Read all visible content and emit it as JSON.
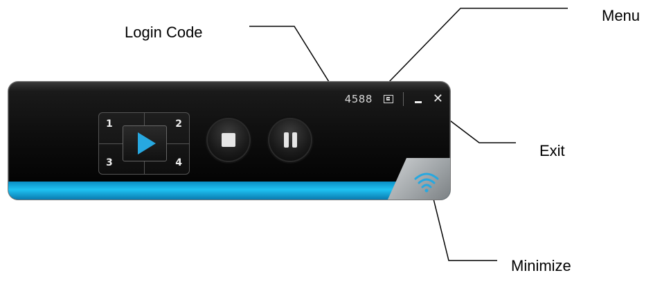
{
  "callouts": {
    "login_code": "Login Code",
    "menu": "Menu",
    "exit": "Exit",
    "minimize": "Minimize"
  },
  "player": {
    "login_code": "4588",
    "split_numbers": [
      "1",
      "2",
      "3",
      "4"
    ],
    "icons": {
      "menu": "menu-icon",
      "minimize": "minimize-icon",
      "close": "close-icon",
      "play": "play-icon",
      "stop": "stop-icon",
      "pause": "pause-icon",
      "wifi": "wifi-icon"
    },
    "colors": {
      "accent": "#1fc2f2",
      "play": "#27a8e0"
    }
  }
}
